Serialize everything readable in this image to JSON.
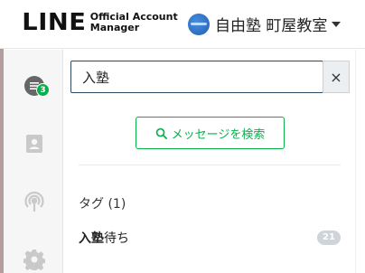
{
  "header": {
    "logo_main": "LINE",
    "logo_sub_line1": "Official Account",
    "logo_sub_line2": "Manager",
    "account_name": "自由塾 町屋教室"
  },
  "sidebar": {
    "chat_badge": "3",
    "items": [
      {
        "icon": "chat-icon"
      },
      {
        "icon": "contact-card-icon"
      },
      {
        "icon": "broadcast-icon"
      },
      {
        "icon": "gear-icon"
      }
    ]
  },
  "search": {
    "value": "入塾",
    "clear_label": "×",
    "message_search_label": "メッセージを検索"
  },
  "tags": {
    "header": "タグ (1)",
    "items": [
      {
        "match": "入塾",
        "rest": "待ち",
        "count": "21"
      }
    ]
  },
  "colors": {
    "accent_green": "#08b04c",
    "badge_gray": "#cfd4d9"
  }
}
